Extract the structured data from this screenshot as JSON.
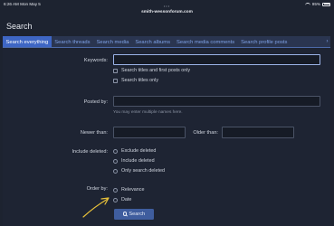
{
  "statusbar": {
    "time": "6:26 AM",
    "date": "Mon May 5",
    "battery": "95%"
  },
  "browser": {
    "url": "smith-wessonforum.com"
  },
  "page": {
    "title": "Search"
  },
  "tabs": [
    {
      "label": "Search everything",
      "active": true
    },
    {
      "label": "Search threads"
    },
    {
      "label": "Search media"
    },
    {
      "label": "Search albums"
    },
    {
      "label": "Search media comments"
    },
    {
      "label": "Search profile posts"
    }
  ],
  "form": {
    "keywords_label": "Keywords:",
    "keywords_value": "",
    "titles_first_posts": "Search titles and first posts only",
    "titles_only": "Search titles only",
    "posted_by_label": "Posted by:",
    "posted_by_value": "",
    "posted_by_hint": "You may enter multiple names here.",
    "newer_than_label": "Newer than:",
    "older_than_label": "Older than:",
    "include_deleted_label": "Include deleted:",
    "deleted_options": [
      "Exclude deleted",
      "Include deleted",
      "Only search deleted"
    ],
    "order_by_label": "Order by:",
    "order_options": [
      "Relevance",
      "Date"
    ],
    "search_button": "Search"
  },
  "colors": {
    "background": "#1d2330",
    "tab_active": "#3e66c4",
    "tab_text": "#7fa2e6",
    "button": "#3f5d9e",
    "annotation_arrow": "#e8c13a"
  },
  "icons": {
    "search_button_icon": "search-icon",
    "tab_scroll": "chevron-right-icon"
  }
}
